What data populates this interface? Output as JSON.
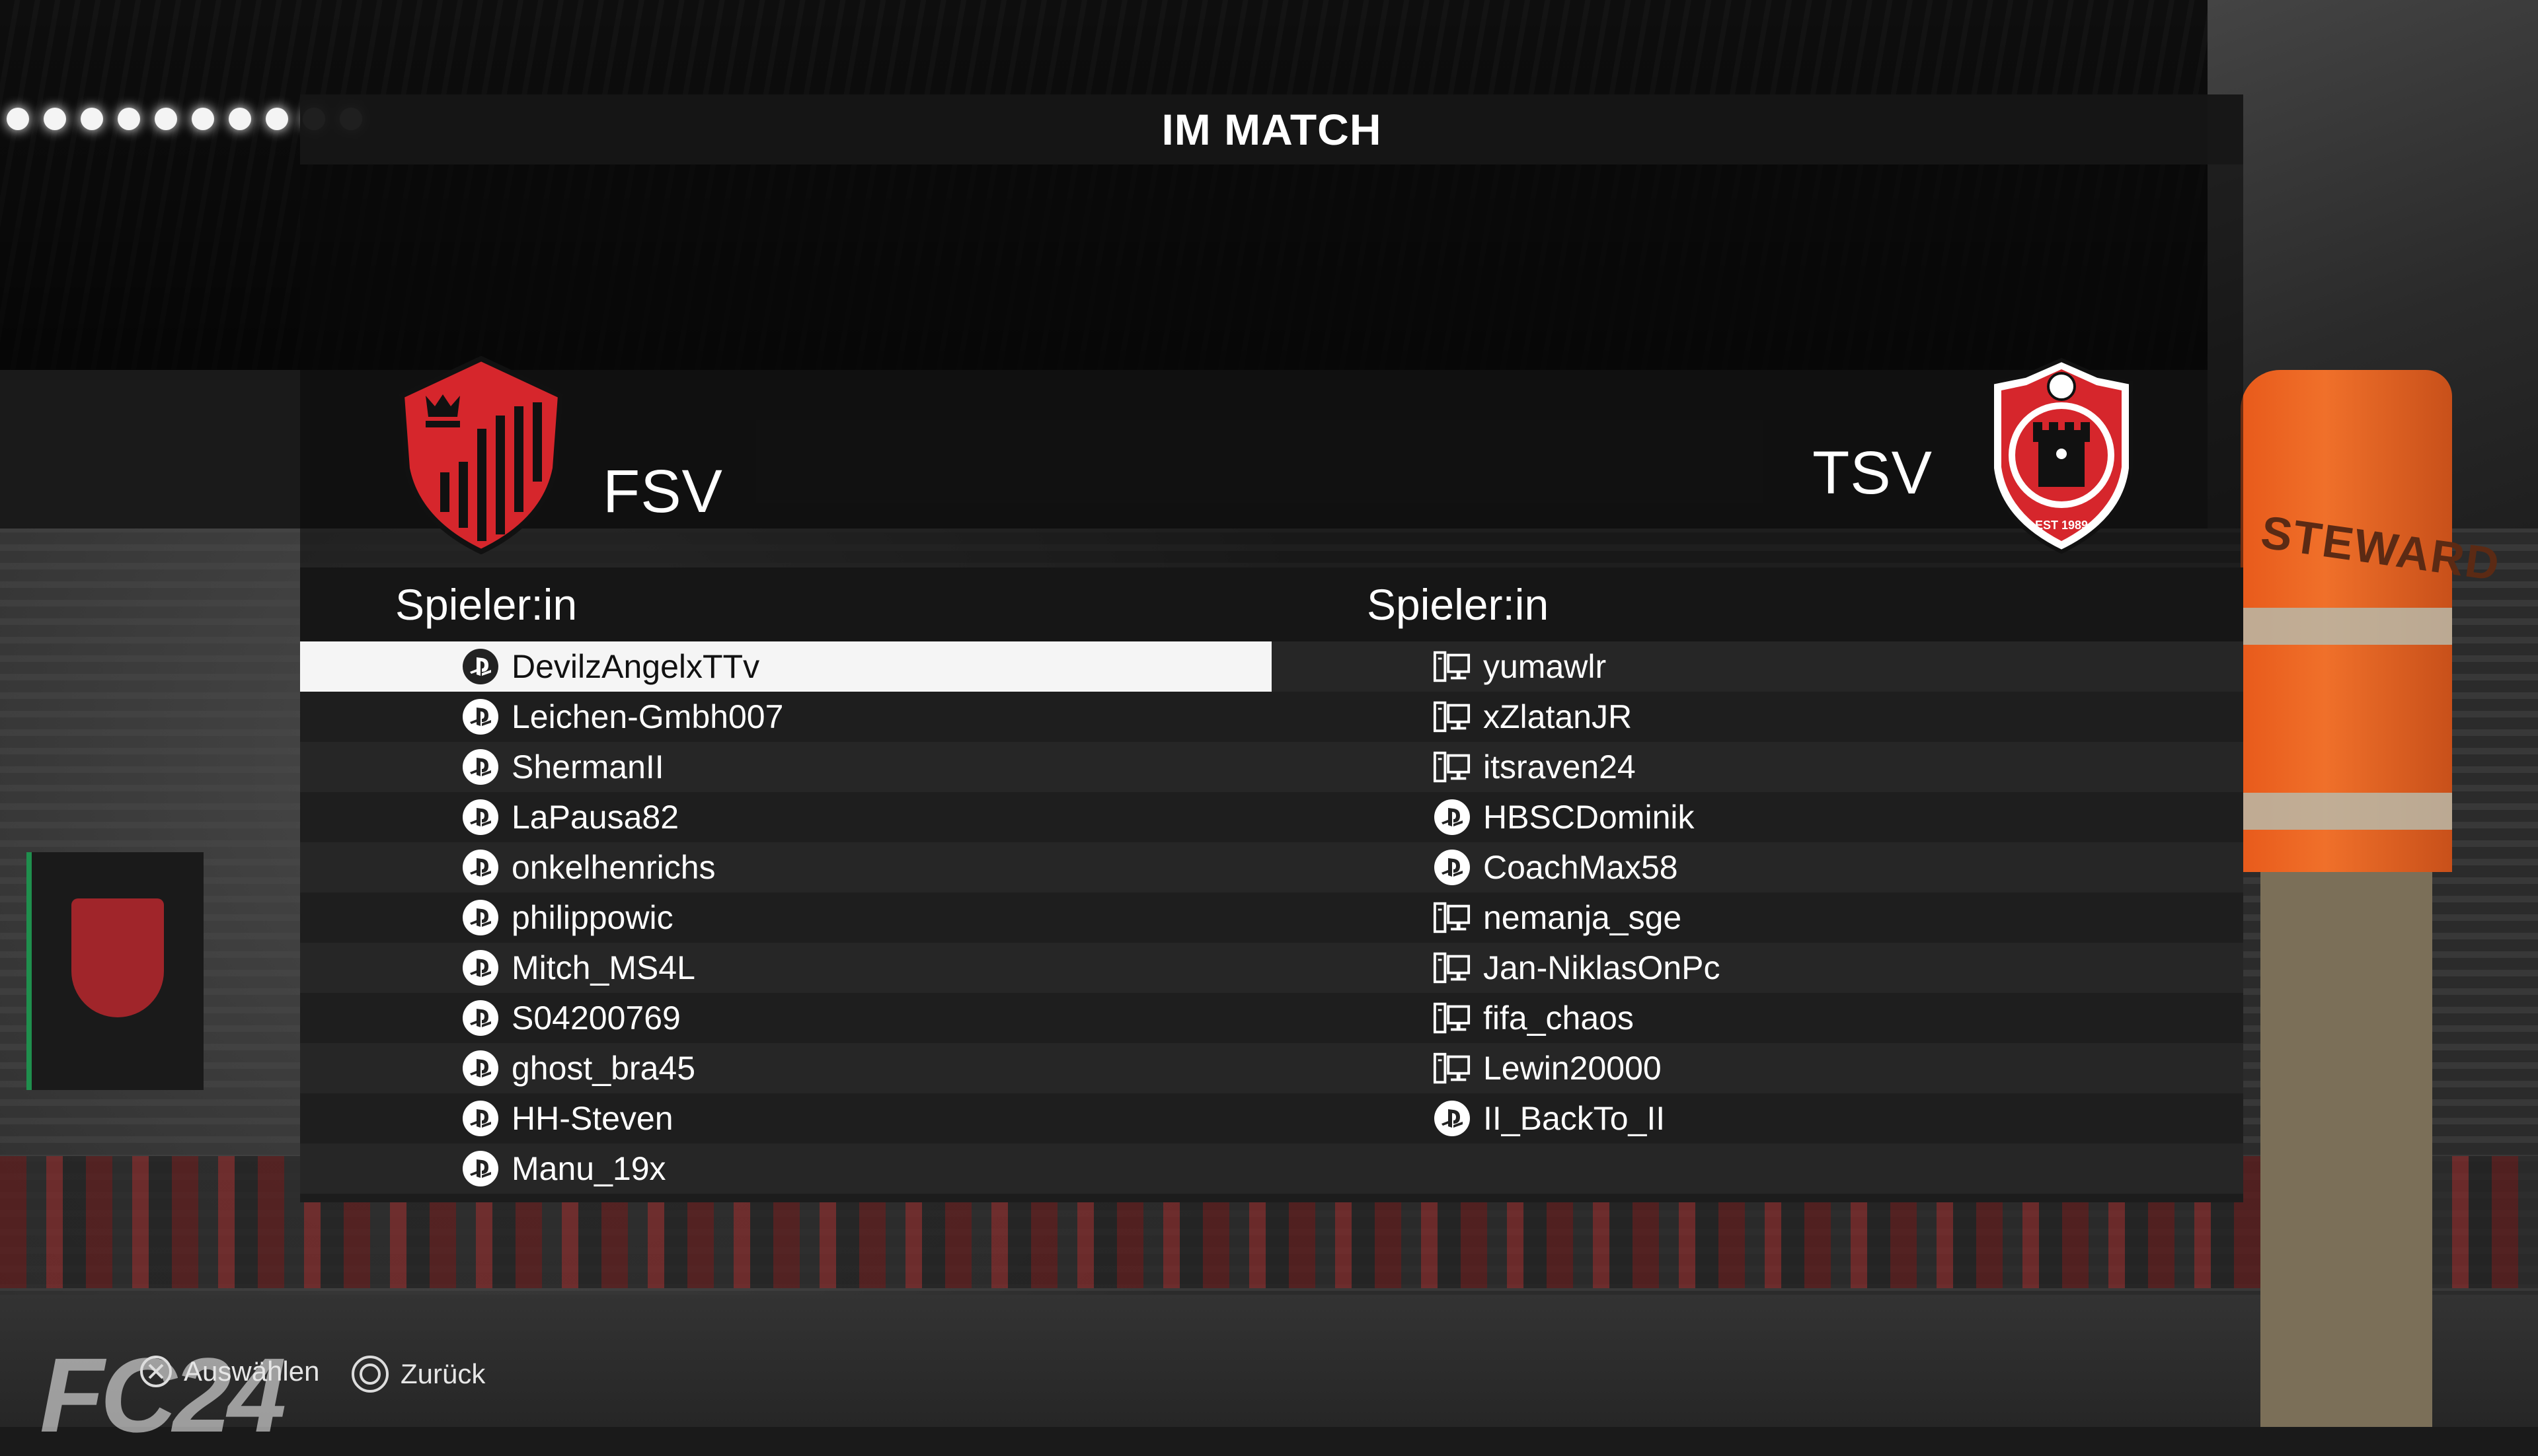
{
  "screen": {
    "title": "IM MATCH",
    "background_watermark": "FC24",
    "steward_text": "STEWARD"
  },
  "home_team": {
    "name": "FSV",
    "crest_colors": {
      "primary": "#d6262c",
      "secondary": "#111111"
    },
    "column_header": "Spieler:in",
    "players": [
      {
        "name": "DevilzAngelxTTv",
        "platform": "playstation",
        "selected": true
      },
      {
        "name": "Leichen-Gmbh007",
        "platform": "playstation"
      },
      {
        "name": "ShermanII",
        "platform": "playstation"
      },
      {
        "name": "LaPausa82",
        "platform": "playstation"
      },
      {
        "name": "onkelhenrichs",
        "platform": "playstation"
      },
      {
        "name": "philippowic",
        "platform": "playstation"
      },
      {
        "name": "Mitch_MS4L",
        "platform": "playstation"
      },
      {
        "name": "S04200769",
        "platform": "playstation"
      },
      {
        "name": "ghost_bra45",
        "platform": "playstation"
      },
      {
        "name": "HH-Steven",
        "platform": "playstation"
      },
      {
        "name": "Manu_19x",
        "platform": "playstation"
      }
    ]
  },
  "away_team": {
    "name": "TSV",
    "crest_text": "EST 1989",
    "crest_colors": {
      "primary": "#d6262c",
      "secondary": "#111111",
      "accent": "#ffffff"
    },
    "column_header": "Spieler:in",
    "players": [
      {
        "name": "yumawlr",
        "platform": "pc"
      },
      {
        "name": "xZlatanJR",
        "platform": "pc"
      },
      {
        "name": "itsraven24",
        "platform": "pc"
      },
      {
        "name": "HBSCDominik",
        "platform": "playstation"
      },
      {
        "name": "CoachMax58",
        "platform": "playstation"
      },
      {
        "name": "nemanja_sge",
        "platform": "pc"
      },
      {
        "name": "Jan-NiklasOnPc",
        "platform": "pc"
      },
      {
        "name": "fifa_chaos",
        "platform": "pc"
      },
      {
        "name": "Lewin20000",
        "platform": "pc"
      },
      {
        "name": "II_BackTo_II",
        "platform": "playstation"
      }
    ]
  },
  "footer": {
    "select_label": "Auswählen",
    "back_label": "Zurück"
  },
  "colors": {
    "panel_dark": "#161616",
    "row_odd": "#262626",
    "row_even": "#1e1e1e",
    "selected_row": "#f5f5f5",
    "text": "#ffffff"
  }
}
